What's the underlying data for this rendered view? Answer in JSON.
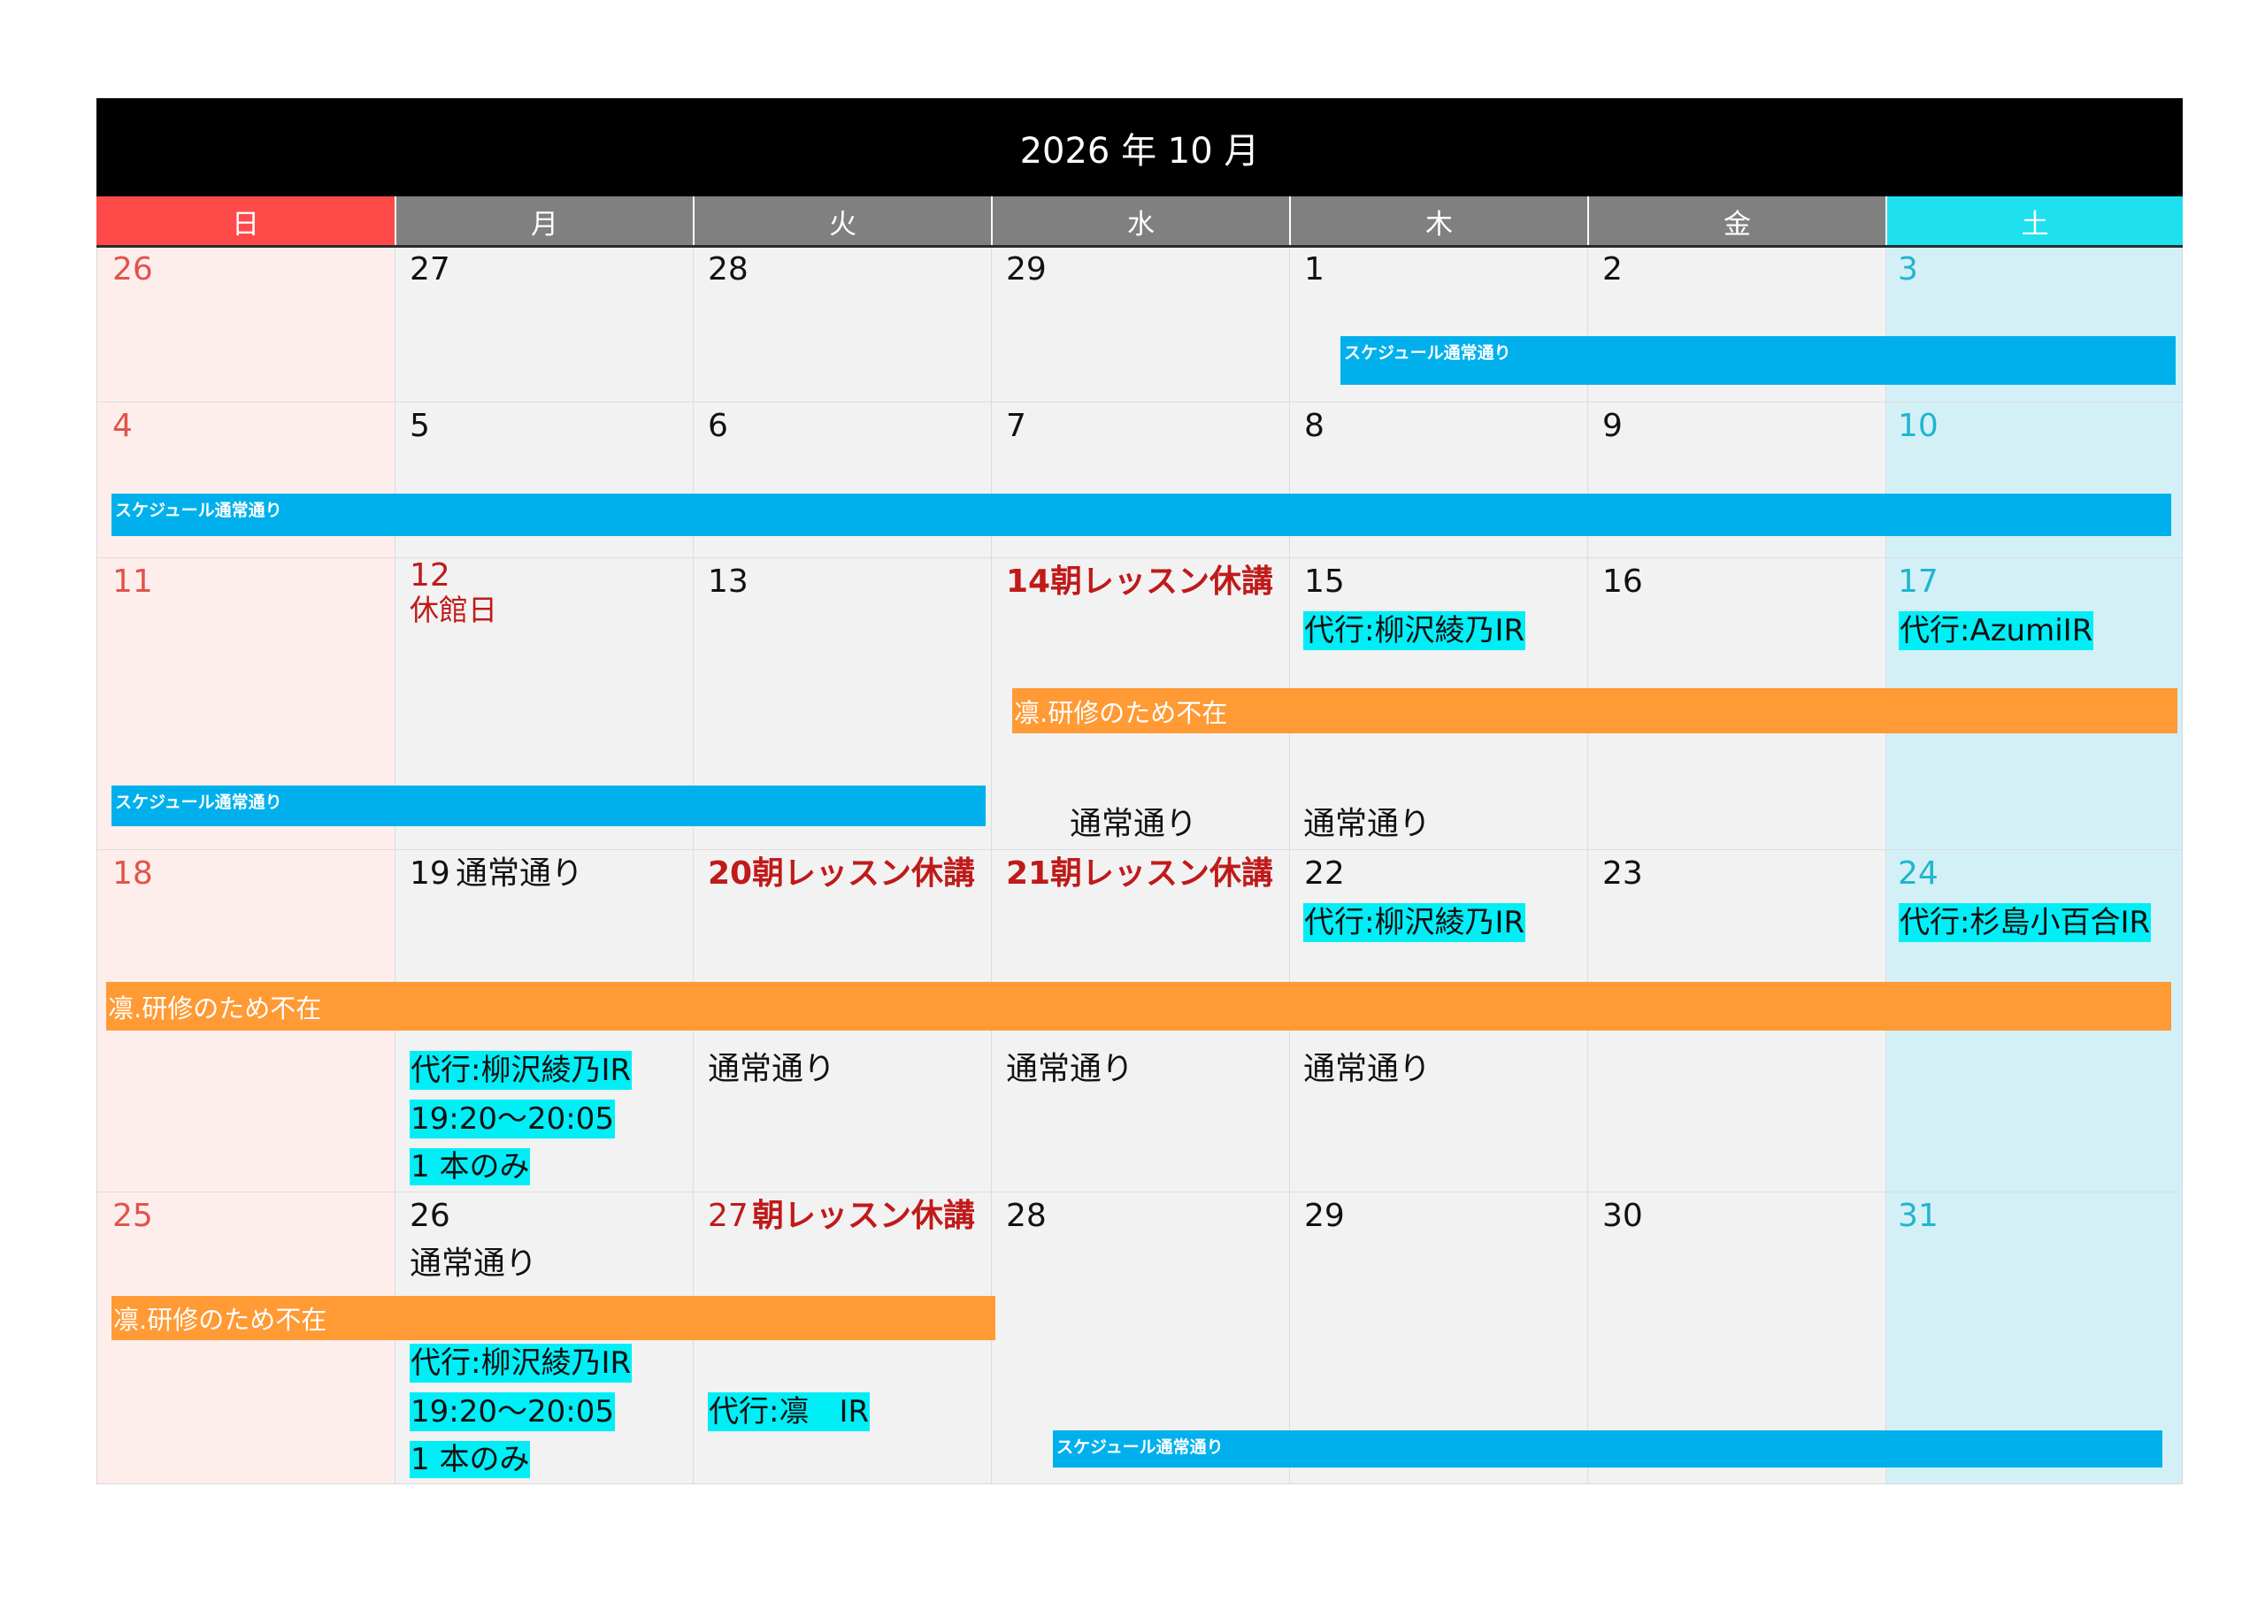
{
  "title": "2026 年 10 月",
  "colors": {
    "title_bg": "#000000",
    "sunday_header": "#ff4a4a",
    "weekday_header": "#808080",
    "saturday_header": "#1fe0ee",
    "sunday_column": "#fdeeec",
    "saturday_column": "#d3f0f7",
    "blue_bar": "#00b0ec",
    "orange_bar": "#ff9a35",
    "cyan_highlight": "#00eef6",
    "red_text": "#c01a1a"
  },
  "weekdays": [
    "日",
    "月",
    "火",
    "水",
    "木",
    "金",
    "土"
  ],
  "weeks": [
    {
      "days": [
        "26",
        "27",
        "28",
        "29",
        "1",
        "2",
        "3"
      ]
    },
    {
      "days": [
        "4",
        "5",
        "6",
        "7",
        "8",
        "9",
        "10"
      ]
    },
    {
      "days": [
        "11",
        "12",
        "13",
        "14",
        "15",
        "16",
        "17"
      ]
    },
    {
      "days": [
        "18",
        "19",
        "20",
        "21",
        "22",
        "23",
        "24"
      ]
    },
    {
      "days": [
        "25",
        "26",
        "27",
        "28",
        "29",
        "30",
        "31"
      ]
    }
  ],
  "labels": {
    "closed": "休館日",
    "morning_cancel": "朝レッスン休講",
    "normal": "通常通り",
    "sub_yanagisawa": "代行:柳沢綾乃IR",
    "sub_azumi": "代行:AzumiIR",
    "sub_sugishima": "代行:杉島小百合IR",
    "sub_rin": "代行:凛　IR",
    "time": "19:20〜20:05",
    "only_one": "1 本のみ"
  },
  "bars": {
    "schedule_normal": "スケジュール通常通り",
    "rin_training": "凛.研修のため不在"
  }
}
